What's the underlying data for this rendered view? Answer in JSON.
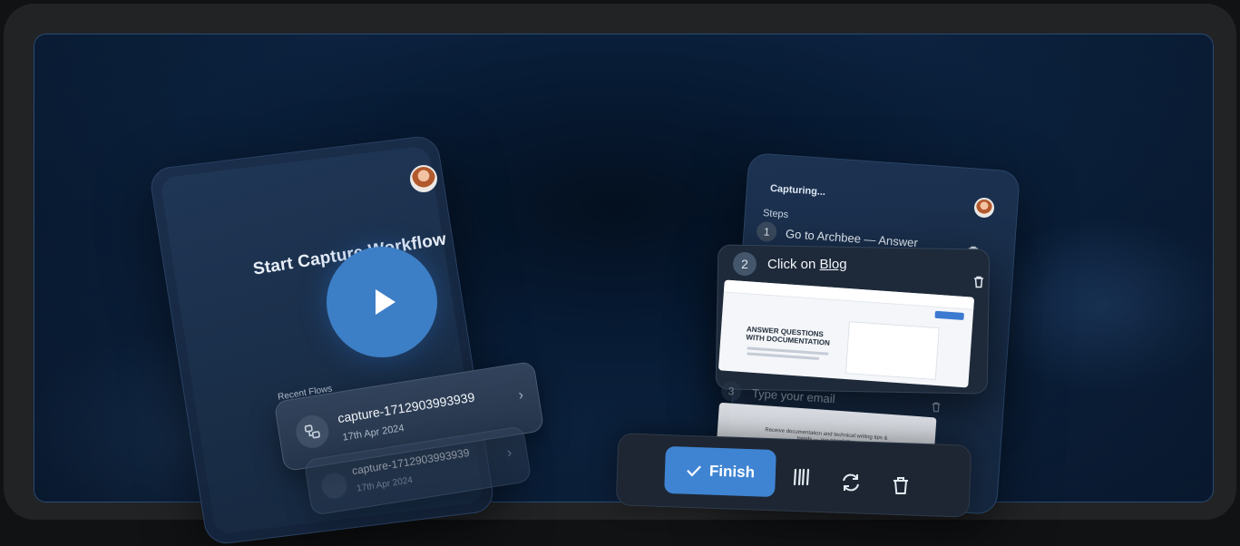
{
  "left_card": {
    "title": "Start Capture Workflow",
    "recent_label": "Recent Flows",
    "flows": [
      {
        "name": "capture-1712903993939",
        "date": "17th Apr 2024"
      },
      {
        "name": "capture-1712903993939",
        "date": "17th Apr 2024"
      }
    ]
  },
  "right_card": {
    "status": "Capturing...",
    "steps_label": "Steps",
    "steps": [
      {
        "number": "1",
        "text": "Go to Archbee — Answer"
      },
      {
        "number": "2",
        "text_prefix": "Click on ",
        "text_link": "Blog"
      },
      {
        "number": "3",
        "text": "Type your email"
      }
    ],
    "screenshot_heading": "ANSWER QUESTIONS WITH DOCUMENTATION",
    "screenshot2_text": "Receive documentation and technical writing tips & trends — our newsletter"
  },
  "toolbar": {
    "finish_label": "Finish",
    "pause_icon": "pause-icon",
    "refresh_icon": "refresh-icon",
    "trash_icon": "trash-icon"
  },
  "colors": {
    "accent": "#3f84d2",
    "background": "#0b2140"
  }
}
